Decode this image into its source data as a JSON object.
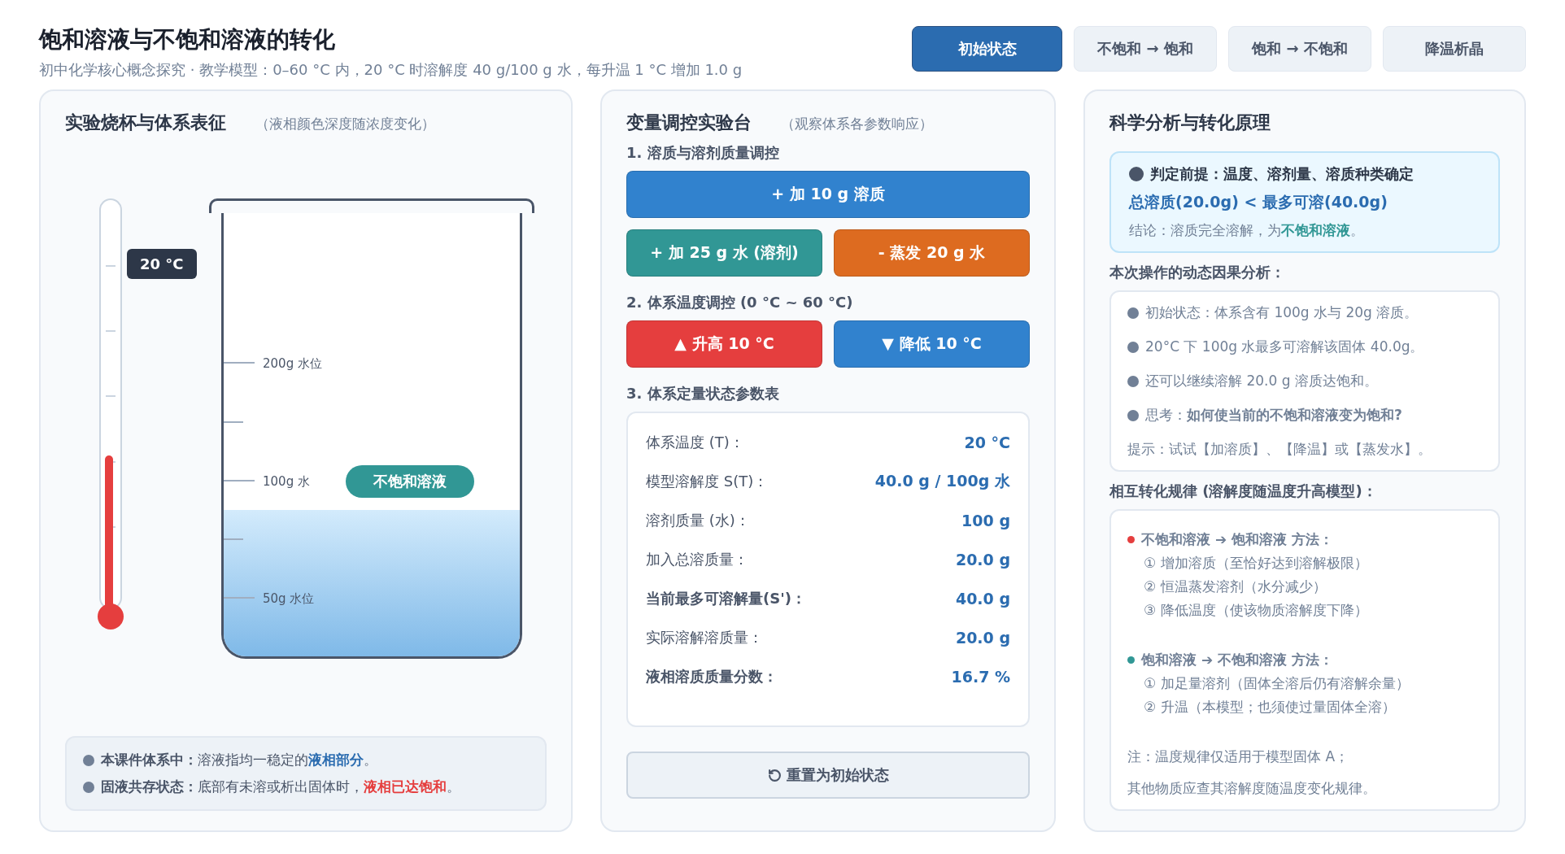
{
  "header": {
    "title": "饱和溶液与不饱和溶液的转化",
    "subtitle": "初中化学核心概念探究 · 教学模型：0–60 °C 内，20 °C 时溶解度 40 g/100 g 水，每升温 1 °C 增加 1.0 g"
  },
  "tabs": [
    {
      "label": "初始状态",
      "selected": true
    },
    {
      "label": "不饱和 → 饱和",
      "selected": false
    },
    {
      "label": "饱和 → 不饱和",
      "selected": false
    },
    {
      "label": "降温析晶",
      "selected": false
    }
  ],
  "beaker_panel": {
    "title": "实验烧杯与体系表征",
    "hint": "（液相颜色深度随浓度变化）",
    "thermometer": {
      "level": 0.4,
      "reading": "20 °C"
    },
    "beaker": {
      "level": 0.33,
      "marks": [
        "200g 水位",
        "100g 水",
        "50g 水位"
      ],
      "state_label": "不饱和溶液"
    },
    "notes": [
      {
        "kind": "info",
        "label": "本课件体系中：",
        "text": "溶液指均一稳定的",
        "highlight": "液相部分",
        "end": "。"
      },
      {
        "kind": "warning",
        "label": "固液共存状态：",
        "text": "底部有未溶或析出固体时，",
        "highlight": "液相已达饱和",
        "end": "。"
      }
    ]
  },
  "control_panel": {
    "title": "变量调控实验台",
    "hint": "（观察体系各参数响应）",
    "mass_section": {
      "title": "1. 溶质与溶剂质量调控",
      "buttons": [
        {
          "label": "+ 加 10 g 溶质",
          "kind": "blue",
          "wide": true
        },
        {
          "label": "+ 加 25 g 水 (溶剂)",
          "kind": "teal",
          "wide": false
        },
        {
          "label": "- 蒸发 20 g 水",
          "kind": "orange",
          "wide": false
        }
      ]
    },
    "temperature_section": {
      "title": "2. 体系温度调控 (0 °C ~ 60 °C)",
      "buttons": [
        {
          "label": "▲ 升高 10 °C",
          "kind": "red",
          "wide": false
        },
        {
          "label": "▼ 降低 10 °C",
          "kind": "blue",
          "wide": false
        }
      ]
    },
    "table_section": {
      "title": "3. 体系定量状态参数表",
      "rows": [
        {
          "label": "体系温度 (T)：",
          "value": "20 °C",
          "bold": false
        },
        {
          "label": "模型溶解度 S(T)：",
          "value": "40.0 g / 100g 水",
          "bold": false
        },
        {
          "label": "溶剂质量 (水)：",
          "value": "100 g",
          "bold": false
        },
        {
          "label": "加入总溶质量：",
          "value": "20.0 g",
          "bold": false
        },
        {
          "label": "当前最多可溶解量(S')：",
          "value": "40.0 g",
          "bold": true
        },
        {
          "label": "实际溶解溶质量：",
          "value": "20.0 g",
          "bold": false
        },
        {
          "label": "液相溶质质量分数：",
          "value": "16.7 %",
          "bold": true
        }
      ]
    },
    "reset_button": "重置为初始状态"
  },
  "analysis_panel": {
    "title": "科学分析与转化原理",
    "verdict": {
      "premise": "判定前提：温度、溶剂量、溶质种类确定",
      "comparison": "总溶质(20.0g) < 最多可溶(40.0g)",
      "conclusion": "结论：溶质完全溶解，为",
      "conclusion_highlight": "不饱和溶液",
      "conclusion_end": "。"
    },
    "dynamics_title": "本次操作的动态因果分析：",
    "dynamics": [
      "初始状态：体系含有 100g 水与 20g 溶质。",
      "20°C 下 100g 水最多可溶解该固体 40.0g。",
      "还可以继续溶解 20.0 g 溶质达饱和。",
      "思考：**如何使当前的不饱和溶液变为饱和?**"
    ],
    "dynamics_hint": "提示：试试【加溶质】、【降温】或【蒸发水】。",
    "rules_title": "相互转化规律 (溶解度随温度升高模型)：",
    "rules": [
      {
        "title": "不饱和溶液 ➔ 饱和溶液 方法：",
        "color": "#e53e3e",
        "steps": [
          "① 增加溶质（至恰好达到溶解极限）",
          "② 恒温蒸发溶剂（水分减少）",
          "③ 降低温度（使该物质溶解度下降）"
        ]
      },
      {
        "title": "饱和溶液 ➔ 不饱和溶液 方法：",
        "color": "#319795",
        "steps": [
          "① 加足量溶剂（固体全溶后仍有溶解余量）",
          "② 升温（本模型；也须使过量固体全溶）"
        ]
      }
    ],
    "rules_note": [
      "注：温度规律仅适用于模型固体 A；",
      "其他物质应查其溶解度随温度变化规律。"
    ]
  }
}
